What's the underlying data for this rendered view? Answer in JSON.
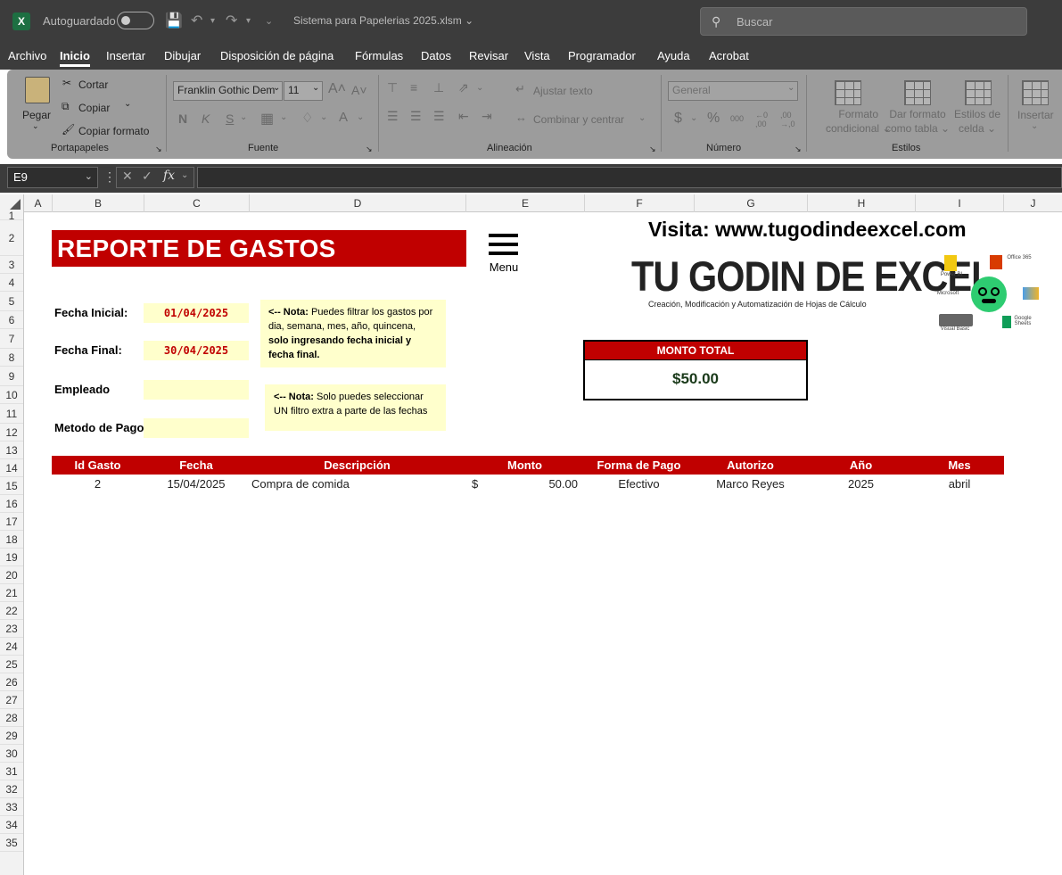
{
  "titlebar": {
    "autosave_label": "Autoguardado",
    "filename": "Sistema para Papelerias 2025.xlsm",
    "search_placeholder": "Buscar"
  },
  "menu": {
    "tabs": [
      "Archivo",
      "Inicio",
      "Insertar",
      "Dibujar",
      "Disposición de página",
      "Fórmulas",
      "Datos",
      "Revisar",
      "Vista",
      "Programador",
      "Ayuda",
      "Acrobat"
    ],
    "active": "Inicio"
  },
  "ribbon": {
    "clipboard": {
      "paste": "Pegar",
      "cut": "Cortar",
      "copy": "Copiar",
      "format_painter": "Copiar formato",
      "group": "Portapapeles"
    },
    "font": {
      "name": "Franklin Gothic Dem",
      "size": "11",
      "bold": "N",
      "italic": "K",
      "underline": "S",
      "group": "Fuente"
    },
    "alignment": {
      "wrap": "Ajustar texto",
      "merge": "Combinar y centrar",
      "group": "Alineación"
    },
    "number": {
      "format": "General",
      "currency": "$",
      "percent": "%",
      "thousands": "000",
      "group": "Número"
    },
    "styles": {
      "conditional": [
        "Formato",
        "condicional"
      ],
      "as_table": [
        "Dar formato",
        "como tabla"
      ],
      "cell_styles": [
        "Estilos de",
        "celda"
      ],
      "group": "Estilos"
    },
    "cells": {
      "insert": "Insertar"
    }
  },
  "formula_bar": {
    "name_box": "E9",
    "fx": "fx",
    "value": ""
  },
  "columns": [
    "A",
    "B",
    "C",
    "D",
    "E",
    "F",
    "G",
    "H",
    "I",
    "J"
  ],
  "rows": [
    "1",
    "2",
    "3",
    "4",
    "5",
    "6",
    "7",
    "8",
    "9",
    "10",
    "11",
    "12",
    "13",
    "14",
    "15",
    "16",
    "17",
    "18",
    "19",
    "20",
    "21",
    "22",
    "23",
    "24",
    "25",
    "26",
    "27",
    "28",
    "29",
    "30",
    "31",
    "32",
    "33",
    "34",
    "35"
  ],
  "report": {
    "title": "REPORTE DE GASTOS",
    "menu_label": "Menu",
    "fecha_inicial_label": "Fecha Inicial:",
    "fecha_inicial": "01/04/2025",
    "fecha_final_label": "Fecha Final:",
    "fecha_final": "30/04/2025",
    "empleado_label": "Empleado",
    "empleado": "",
    "metodo_label": "Metodo de Pago",
    "metodo": "",
    "note1_bold1": "<-- Nota:",
    "note1_text1": " Puedes filtrar los gastos por dia, semana, mes, año, quincena, ",
    "note1_bold2": "solo ingresando fecha inicial y fecha final.",
    "note2_bold": "<-- Nota:",
    "note2_text": " Solo puedes seleccionar UN filtro extra a parte de las fechas",
    "website": "Visita: www.tugodindeexcel.com",
    "brand": "TU GODIN DE EXCEL",
    "tagline": "Creación, Modificación y Automatización de Hojas de Cálculo",
    "logos": [
      "Power BI",
      "Office 365",
      "Microsoft",
      "Visual Basic",
      "Google Sheets"
    ],
    "monto_label": "MONTO TOTAL",
    "monto_value": "$50.00"
  },
  "table": {
    "headers": [
      "Id Gasto",
      "Fecha",
      "Descripción",
      "Monto",
      "Forma de Pago",
      "Autorizo",
      "Año",
      "Mes"
    ],
    "rows": [
      {
        "id": "2",
        "fecha": "15/04/2025",
        "descripcion": "Compra de comida",
        "currency": "$",
        "monto": "50.00",
        "forma_pago": "Efectivo",
        "autorizo": "Marco Reyes",
        "anio": "2025",
        "mes": "abril"
      }
    ]
  },
  "colors": {
    "accent_red": "#c00000",
    "input_yellow": "#ffffcc",
    "excel_green": "#1d6f42"
  }
}
